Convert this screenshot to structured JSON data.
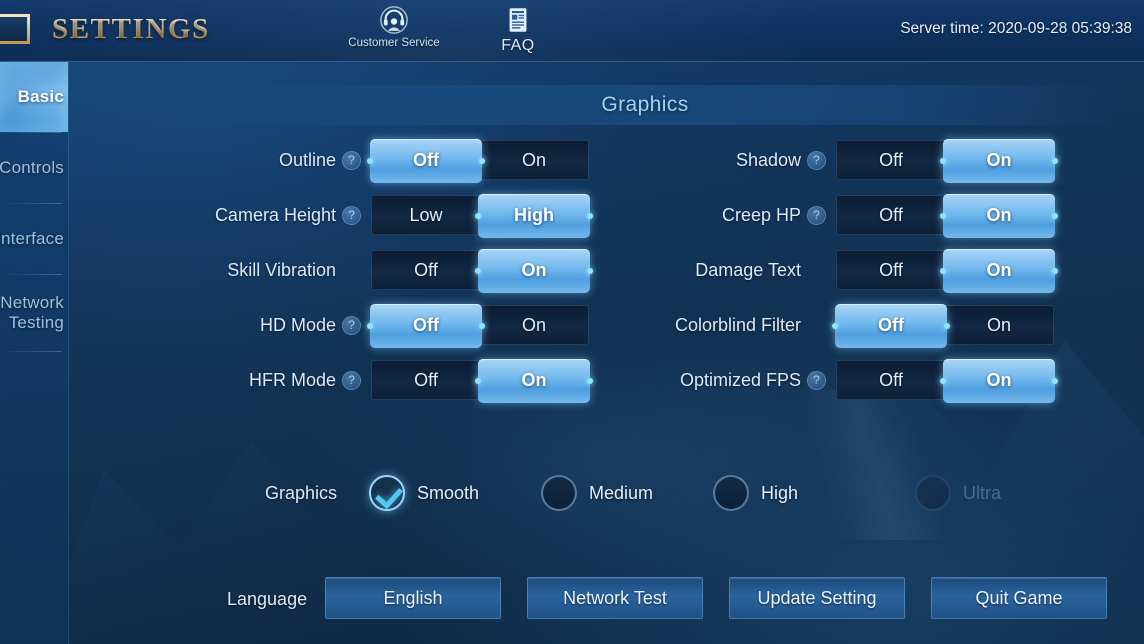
{
  "header": {
    "title": "SETTINGS",
    "back_icon": "back-arrow-icon",
    "server_time": "Server time: 2020-09-28 05:39:38",
    "tools": [
      {
        "label": "Customer Service",
        "icon": "customer-service-icon"
      },
      {
        "label": "FAQ",
        "icon": "faq-document-icon"
      }
    ]
  },
  "sidebar": {
    "items": [
      {
        "label": "Basic",
        "active": true
      },
      {
        "label": "Controls",
        "active": false
      },
      {
        "label": "Interface",
        "active": false
      },
      {
        "label": "Network\nTesting",
        "active": false
      }
    ]
  },
  "panel": {
    "title": "Graphics"
  },
  "settings": {
    "help_glyph": "?",
    "left_column": [
      {
        "label": "Outline",
        "help": true,
        "options": [
          "Off",
          "On"
        ],
        "selected": 0
      },
      {
        "label": "Camera Height",
        "help": true,
        "options": [
          "Low",
          "High"
        ],
        "selected": 1
      },
      {
        "label": "Skill Vibration",
        "help": false,
        "options": [
          "Off",
          "On"
        ],
        "selected": 1
      },
      {
        "label": "HD Mode",
        "help": true,
        "options": [
          "Off",
          "On"
        ],
        "selected": 0
      },
      {
        "label": "HFR Mode",
        "help": true,
        "options": [
          "Off",
          "On"
        ],
        "selected": 1
      }
    ],
    "right_column": [
      {
        "label": "Shadow",
        "help": true,
        "options": [
          "Off",
          "On"
        ],
        "selected": 1
      },
      {
        "label": "Creep HP",
        "help": true,
        "options": [
          "Off",
          "On"
        ],
        "selected": 1
      },
      {
        "label": "Damage Text",
        "help": false,
        "options": [
          "Off",
          "On"
        ],
        "selected": 1
      },
      {
        "label": "Colorblind Filter",
        "help": false,
        "options": [
          "Off",
          "On"
        ],
        "selected": 0
      },
      {
        "label": "Optimized FPS",
        "help": true,
        "options": [
          "Off",
          "On"
        ],
        "selected": 1
      }
    ]
  },
  "quality": {
    "label": "Graphics",
    "help_glyph": "?",
    "options": [
      {
        "label": "Smooth",
        "checked": true,
        "disabled": false
      },
      {
        "label": "Medium",
        "checked": false,
        "disabled": false
      },
      {
        "label": "High",
        "checked": false,
        "disabled": false
      },
      {
        "label": "Ultra",
        "checked": false,
        "disabled": true
      }
    ]
  },
  "bottom": {
    "language_label": "Language",
    "buttons": [
      {
        "label": "English"
      },
      {
        "label": "Network Test"
      },
      {
        "label": "Update Setting"
      },
      {
        "label": "Quit Game"
      }
    ]
  },
  "colors": {
    "accent_blue": "#4f9fe0",
    "knob_highlight": "#8fe4ff",
    "panel_title": "#9fd6f5",
    "gold_title": "#e8d2a0"
  }
}
